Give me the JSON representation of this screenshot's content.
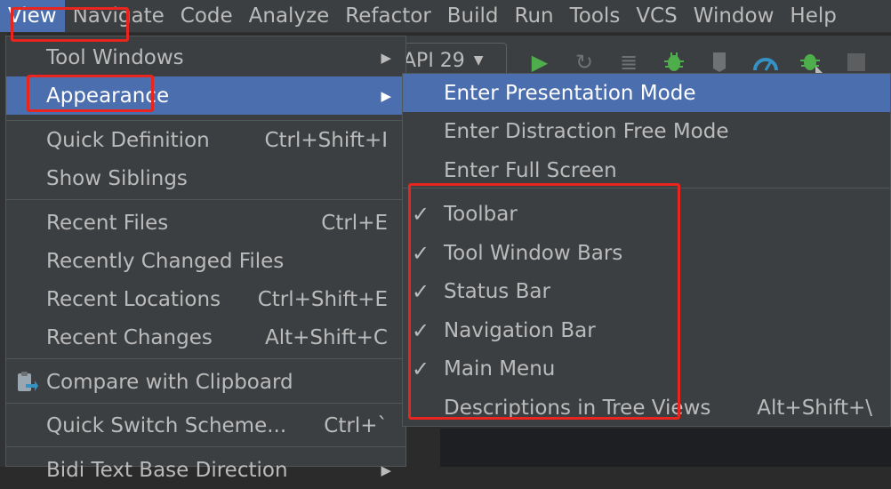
{
  "menubar": {
    "items": [
      {
        "label": "View",
        "name": "menu-view"
      },
      {
        "label": "Navigate",
        "name": "menu-navigate"
      },
      {
        "label": "Code",
        "name": "menu-code"
      },
      {
        "label": "Analyze",
        "name": "menu-analyze"
      },
      {
        "label": "Refactor",
        "name": "menu-refactor"
      },
      {
        "label": "Build",
        "name": "menu-build"
      },
      {
        "label": "Run",
        "name": "menu-run"
      },
      {
        "label": "Tools",
        "name": "menu-tools"
      },
      {
        "label": "VCS",
        "name": "menu-vcs"
      },
      {
        "label": "Window",
        "name": "menu-window"
      },
      {
        "label": "Help",
        "name": "menu-help"
      }
    ]
  },
  "toolbar": {
    "api_label": "API 29",
    "icons": [
      "run-icon",
      "apply-changes-icon",
      "apply-code-changes-icon",
      "debug-icon",
      "attach-debugger-icon",
      "profile-icon",
      "debug-attach-icon",
      "stop-icon"
    ]
  },
  "view_menu": {
    "tool_windows": "Tool Windows",
    "appearance": "Appearance",
    "quick_definition": "Quick Definition",
    "quick_definition_shortcut": "Ctrl+Shift+I",
    "show_siblings": "Show Siblings",
    "recent_files": "Recent Files",
    "recent_files_shortcut": "Ctrl+E",
    "recently_changed_files": "Recently Changed Files",
    "recent_locations": "Recent Locations",
    "recent_locations_shortcut": "Ctrl+Shift+E",
    "recent_changes": "Recent Changes",
    "recent_changes_shortcut": "Alt+Shift+C",
    "compare_with_clipboard": "Compare with Clipboard",
    "quick_switch_scheme": "Quick Switch Scheme...",
    "quick_switch_scheme_shortcut": "Ctrl+`",
    "bidi_text": "Bidi Text Base Direction"
  },
  "appearance_menu": {
    "presentation_mode": "Enter Presentation Mode",
    "distraction_free": "Enter Distraction Free Mode",
    "full_screen": "Enter Full Screen",
    "toolbar": "Toolbar",
    "tool_window_bars": "Tool Window Bars",
    "status_bar": "Status Bar",
    "navigation_bar": "Navigation Bar",
    "main_menu": "Main Menu",
    "descriptions_tree_views": "Descriptions in Tree Views",
    "descriptions_tree_views_shortcut": "Alt+Shift+\\",
    "check_glyph": "✓"
  },
  "colors": {
    "menu_bg": "#3c3f41",
    "selection": "#4b6eaf",
    "annotation": "#e8251f",
    "run_green": "#4eae4b"
  }
}
